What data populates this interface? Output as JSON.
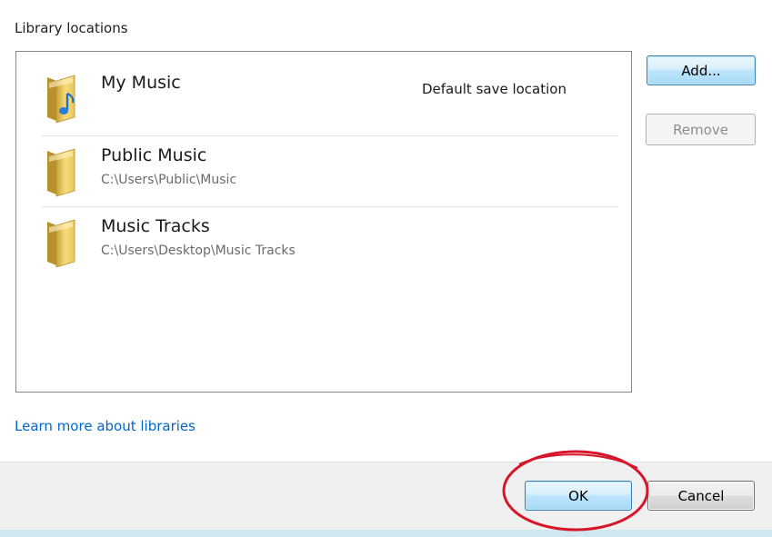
{
  "section_label": "Library locations",
  "locations": [
    {
      "name": "My Music",
      "path": "",
      "tag": "Default save location",
      "icon": "music-folder-icon"
    },
    {
      "name": "Public Music",
      "path": "C:\\Users\\Public\\Music",
      "tag": "",
      "icon": "folder-icon"
    },
    {
      "name": "Music Tracks",
      "path": "C:\\Users\\Desktop\\Music Tracks",
      "tag": "",
      "icon": "folder-icon"
    }
  ],
  "buttons": {
    "add": "Add...",
    "remove": "Remove",
    "ok": "OK",
    "cancel": "Cancel"
  },
  "link": "Learn more about libraries",
  "colors": {
    "link": "#0066cc",
    "highlight": "#d6162a",
    "folder": "#f5d56a",
    "music_note": "#2a7fd4"
  }
}
